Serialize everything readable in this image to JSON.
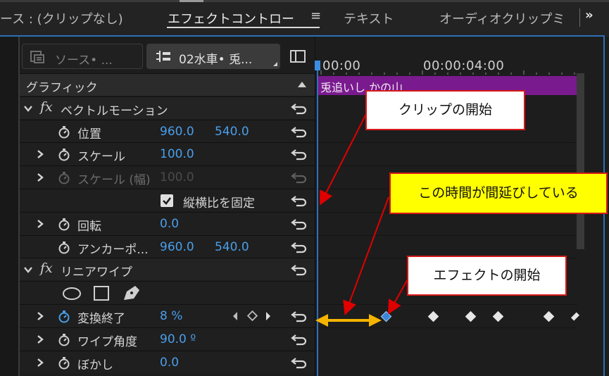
{
  "tabs": {
    "source": "ース : (クリップなし)",
    "effect_controls": "エフェクトコントロー",
    "menu_glyph": "≡",
    "text": "テキスト",
    "audio_mixer": "オーディオクリップミ",
    "more_glyph": "»"
  },
  "header": {
    "source_label": "ソース• ...",
    "clip_label": "02水車• 兎..."
  },
  "timeline": {
    "timecode_start": "00:00",
    "timecode_mid": "00:00:04:00",
    "clip_name": "兎追いし かの山"
  },
  "rows": {
    "graphic": "グラフィック",
    "vector_motion": "ベクトルモーション",
    "position": {
      "label": "位置",
      "x": "960.0",
      "y": "540.0"
    },
    "scale": {
      "label": "スケール",
      "value": "100.0"
    },
    "scale_width": {
      "label": "スケール (幅)",
      "value": "100.0"
    },
    "uniform_scale": "縦横比を固定",
    "rotation": {
      "label": "回転",
      "value": "0.0"
    },
    "anchor": {
      "label": "アンカーポ...",
      "x": "960.0",
      "y": "540.0"
    },
    "linear_wipe": "リニアワイプ",
    "transition_completion": {
      "label": "変換終了",
      "value": "8 %"
    },
    "wipe_angle": {
      "label": "ワイプ角度",
      "value": "90.0 º"
    },
    "feather": {
      "label": "ぼかし",
      "value": "0.0"
    }
  },
  "annotations": {
    "clip_start": "クリップの開始",
    "gap": "この時間が間延びしている",
    "effect_start": "エフェクトの開始"
  },
  "colors": {
    "clip_bar": "#7a1a8f",
    "value_blue": "#4a9eea",
    "callout_border": "#d51919",
    "callout_highlight": "#ffff00",
    "gap_arrow": "#f5b400"
  }
}
